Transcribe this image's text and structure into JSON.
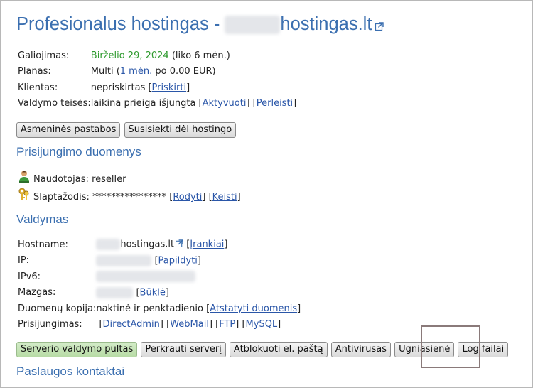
{
  "title": {
    "prefix": "Profesionalus hostingas - ",
    "domain_suffix": "hostingas.lt"
  },
  "info": {
    "galiojimas": {
      "label": "Galiojimas:",
      "date": "Birželio 29, 2024",
      "note": " (liko 6 mėn.)"
    },
    "planas": {
      "label": "Planas:",
      "value": "Multi (",
      "link": "1 mėn.",
      "after": " po 0.00 EUR)"
    },
    "klientas": {
      "label": "Klientas:",
      "value": "nepriskirtas [",
      "link": "Priskirti",
      "after": "]"
    },
    "teises": {
      "label": "Valdymo teisės:",
      "value": "laikina prieiga išjungta [",
      "link1": "Aktyvuoti",
      "mid": "] [",
      "link2": "Perleisti",
      "after": "]"
    }
  },
  "buttons_top": {
    "notes": "Asmeninės pastabos",
    "contact": "Susisiekti dėl hostingo"
  },
  "login_section": {
    "heading": "Prisijungimo duomenys",
    "user_label": "Naudotojas:",
    "user_value": "reseller",
    "pass_label": "Slaptažodis:",
    "pass_value": "****************",
    "show_link": "Rodyti",
    "change_link": "Keisti"
  },
  "manage_section": {
    "heading": "Valdymas",
    "hostname_label": "Hostname:",
    "hostname_value": "hostingas.lt",
    "tools_link": "Įrankiai",
    "ip_label": "IP:",
    "ip_link": "Papildyti",
    "ipv6_label": "IPv6:",
    "node_label": "Mazgas:",
    "node_link": "Būklė",
    "backup_label": "Duomenų kopija:",
    "backup_value": "naktinė ir penktadienio [",
    "backup_link": "Atstatyti duomenis",
    "logins_label": "Prisijungimas:",
    "login_links": [
      "DirectAdmin",
      "WebMail",
      "FTP",
      "MySQL"
    ]
  },
  "buttons_bottom": [
    "Serverio valdymo pultas",
    "Perkrauti serverį",
    "Atblokuoti el. paštą",
    "Antivirusas",
    "Ugniasienė",
    "Log failai"
  ],
  "contacts_heading": "Paslaugos kontaktai",
  "colors": {
    "heading": "#3b6fb0",
    "link": "#2a56a8",
    "date": "#2e9a2e",
    "primary_button": "#c7e4b9"
  }
}
